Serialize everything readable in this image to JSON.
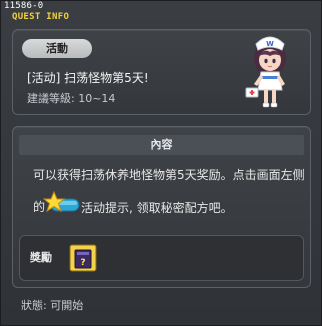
{
  "header": {
    "id": "11586-0",
    "title": "QUEST INFO"
  },
  "event": {
    "badge": "活動",
    "title": "[活动] 扫荡怪物第5天!",
    "level": "建議等級: 10~14"
  },
  "content": {
    "section_title": "內容",
    "description_line1": "可以获得扫荡休养地怪物第5天奖励。点击画面左侧",
    "description_line2_prefix": "的",
    "description_line2_suffix": "活动提示, 领取秘密配方吧。"
  },
  "reward": {
    "label": "獎勵"
  },
  "status": {
    "text": "狀態: 可開始"
  },
  "colors": {
    "header_title": "#f2d23a",
    "panel_border": "#5c6067",
    "background": "#3a3d41"
  },
  "icons": {
    "npc": "nurse-npc-icon",
    "event_hint": "star-icon",
    "reward_item": "recipe-book-icon"
  }
}
